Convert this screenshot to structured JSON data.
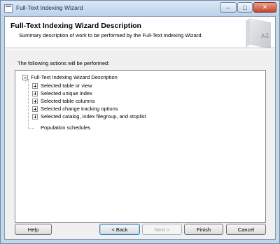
{
  "window": {
    "title": "Full-Text Indexing Wizard",
    "controls": {
      "minimize": "–",
      "maximize": "□",
      "close": "✕"
    }
  },
  "header": {
    "title": "Full-Text Indexing Wizard Description",
    "subtitle": "Summary description of work to be performed by the Full-Text Indexing Wizard.",
    "graphic_text": "AZ"
  },
  "intro": "The following actions will be performed:",
  "tree": {
    "root": "Full-Text Indexing Wizard Description",
    "items": [
      {
        "label": "Selected table or view",
        "expandable": true
      },
      {
        "label": "Selected unique index",
        "expandable": true
      },
      {
        "label": "Selected table columns",
        "expandable": true
      },
      {
        "label": "Selected change tracking options",
        "expandable": true
      },
      {
        "label": "Selected catalog, index filegroup, and stoplist",
        "expandable": true
      },
      {
        "label": "Population schedules",
        "expandable": false
      }
    ]
  },
  "buttons": {
    "help": "Help",
    "back": "< Back",
    "next": "Next >",
    "finish": "Finish",
    "cancel": "Cancel"
  }
}
